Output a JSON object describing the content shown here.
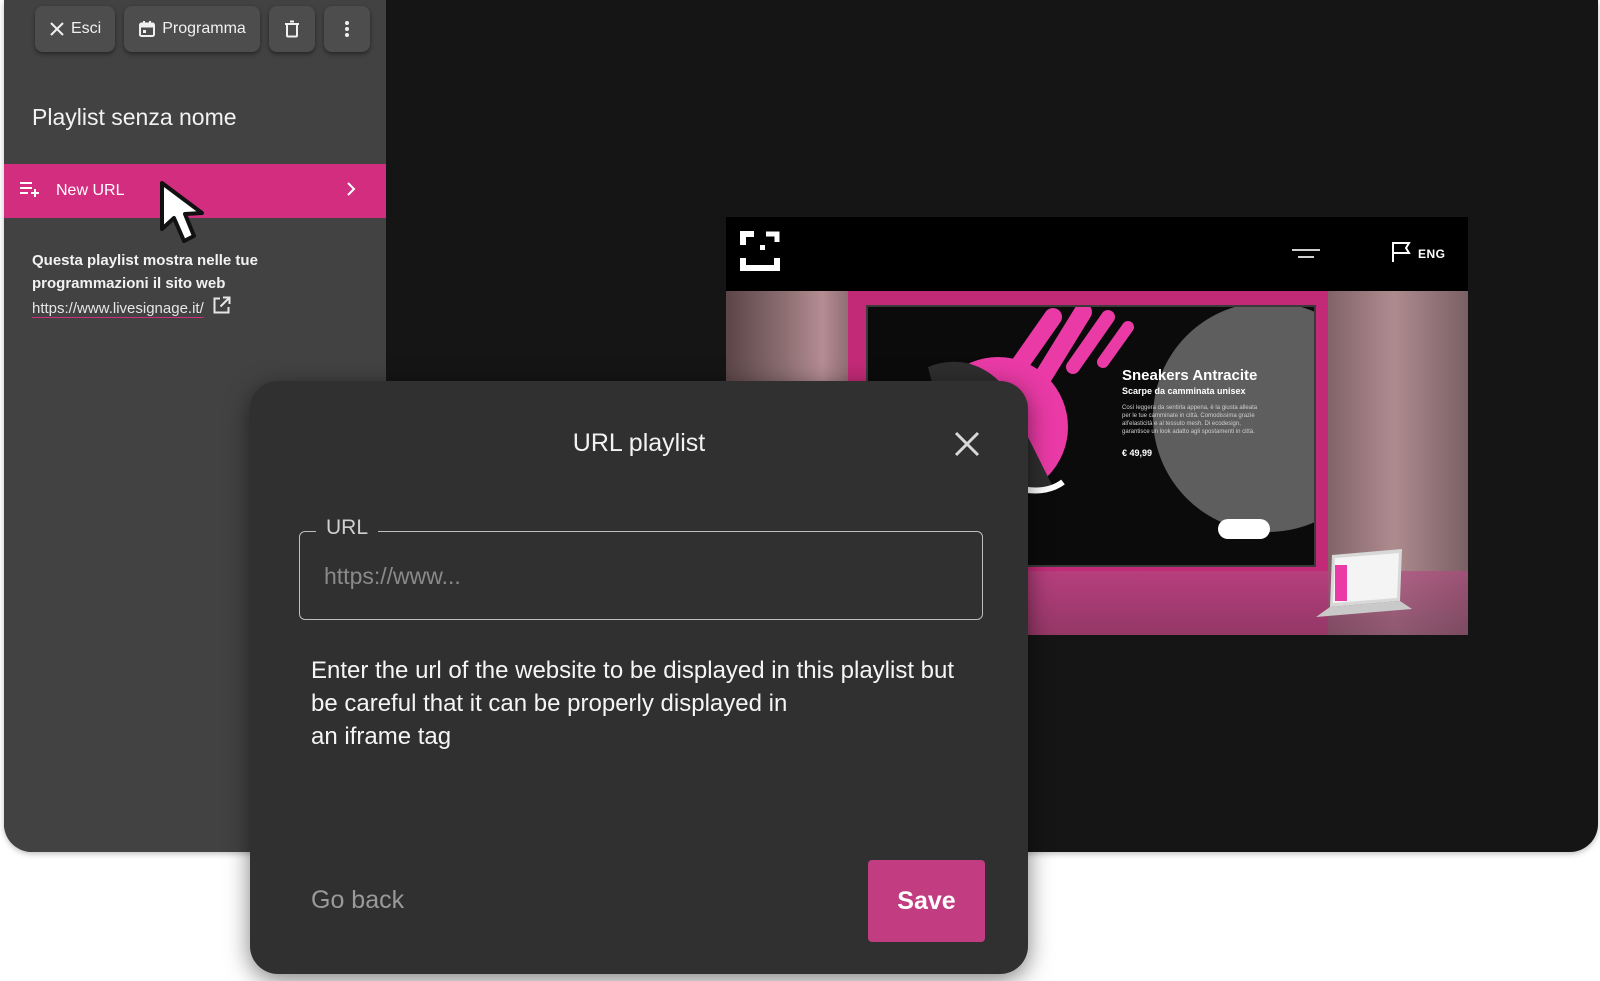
{
  "toolbar": {
    "exit_label": "Esci",
    "schedule_label": "Programma"
  },
  "sidebar": {
    "playlist_title": "Playlist senza nome",
    "new_url_label": "New URL",
    "info_text": "Questa playlist mostra nelle tue programmazioni il sito web",
    "info_link": "https://www.livesignage.it/"
  },
  "preview": {
    "lang_label": "ENG",
    "product_title": "Sneakers Antracite",
    "product_subtitle": "Scarpe da camminata unisex",
    "product_desc": "Così leggera da sentirla appena, è la giusta alleata per le tue camminate in città. Comodissima grazie all'elasticità e al tessuto mesh. Di ecodesign, garantisce un look adatto agli spostamenti in città.",
    "product_price": "€ 49,99"
  },
  "dialog": {
    "title": "URL playlist",
    "url_label": "URL",
    "url_placeholder": "https://www...",
    "description": "Enter the url of the website to be displayed in this playlist but\nbe careful that it can be properly displayed in\nan iframe tag",
    "go_back_label": "Go back",
    "save_label": "Save"
  },
  "colors": {
    "accent": "#d32d80",
    "save_button": "#c23c81",
    "sidebar_bg": "#424242",
    "dialog_bg": "#303030"
  },
  "icons": [
    "close-icon",
    "calendar-icon",
    "trash-icon",
    "more-vertical-icon",
    "playlist-add-icon",
    "chevron-right-icon",
    "mouse-cursor-icon",
    "external-link-icon",
    "fullscreen-logo-icon",
    "menu-icon",
    "flag-icon"
  ]
}
